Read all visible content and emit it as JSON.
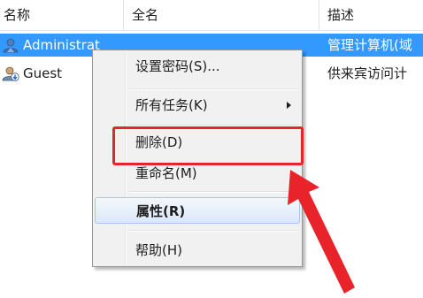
{
  "list": {
    "columns": [
      "名称",
      "全名",
      "描述"
    ],
    "rows": [
      {
        "name": "Administrat",
        "full_name": "",
        "description": "管理计算机(域",
        "icon": "admin-user-icon",
        "selected": true
      },
      {
        "name": "Guest",
        "full_name": "",
        "description": "供来宾访问计",
        "icon": "guest-user-icon",
        "selected": false
      }
    ]
  },
  "context_menu": {
    "items": [
      {
        "label": "设置密码(S)...",
        "submenu": false,
        "hovered": false,
        "bold": false
      },
      {
        "label": "所有任务(K)",
        "submenu": true,
        "hovered": false,
        "bold": false
      },
      {
        "label": "删除(D)",
        "submenu": false,
        "hovered": false,
        "bold": false
      },
      {
        "label": "重命名(M)",
        "submenu": false,
        "hovered": false,
        "bold": false
      },
      {
        "label": "属性(R)",
        "submenu": false,
        "hovered": true,
        "bold": true
      },
      {
        "label": "帮助(H)",
        "submenu": false,
        "hovered": false,
        "bold": false
      }
    ]
  },
  "annotation": {
    "highlighted_item": "删除(D)",
    "color": "#e8242a"
  },
  "colors": {
    "selection": "#3399ff",
    "menu_background": "#f1f1f1",
    "menu_hover_border": "#a9c7ec"
  }
}
